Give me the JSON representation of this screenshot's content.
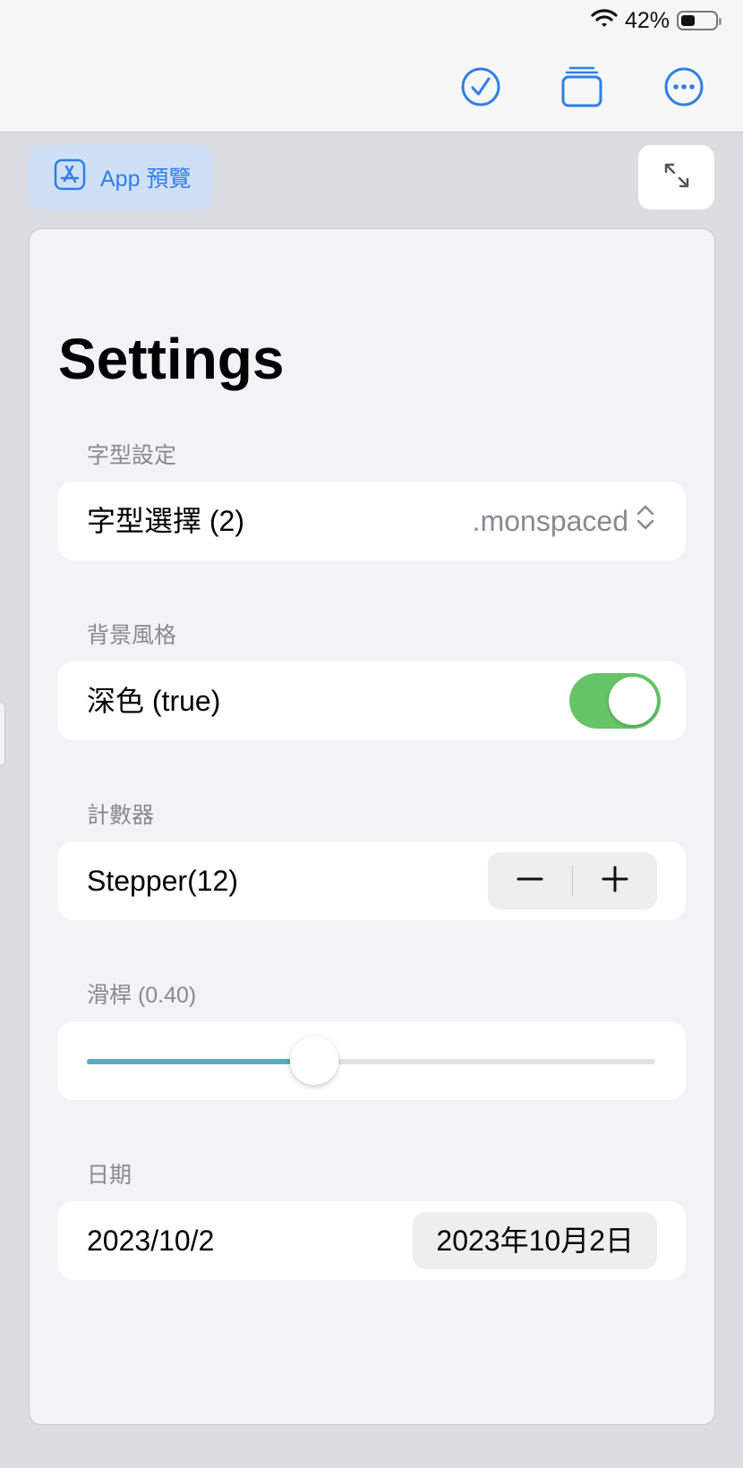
{
  "status_bar": {
    "battery_text": "42%",
    "battery_level": 0.42
  },
  "toolbar": {
    "done_icon": "checkmark-circle-icon",
    "windows_icon": "stacked-windows-icon",
    "more_icon": "ellipsis-circle-icon",
    "accent": "#2f7fe6"
  },
  "preview": {
    "label": "App 預覽",
    "icon": "app-store-icon"
  },
  "page": {
    "title": "Settings"
  },
  "sections": {
    "font": {
      "header": "字型設定",
      "label": "字型選擇 (2)",
      "value": ".monspaced"
    },
    "background": {
      "header": "背景風格",
      "label": "深色 (true)",
      "toggle_on": true,
      "toggle_color": "#65c466"
    },
    "counter": {
      "header": "計數器",
      "label": "Stepper(12)"
    },
    "slider": {
      "header": "滑桿 (0.40)",
      "value": 0.4,
      "fill_color": "#5aa9c0"
    },
    "date": {
      "header": "日期",
      "label": "2023/10/2",
      "value": "2023年10月2日"
    }
  }
}
